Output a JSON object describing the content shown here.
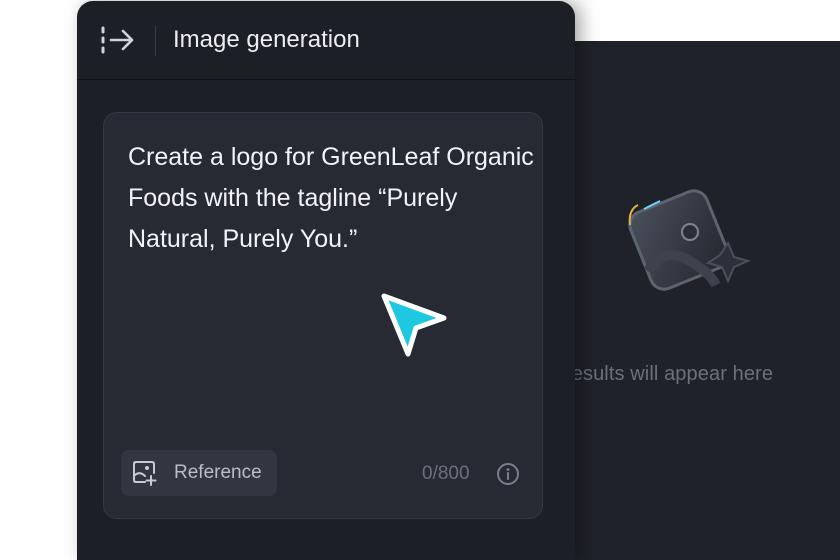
{
  "colors": {
    "panel_background": "#1c1f26",
    "card_background": "#272a33",
    "accent_cursor": "#1ec8e0"
  },
  "header": {
    "collapse_icon": "panel-collapse-arrow-icon",
    "title": "Image generation"
  },
  "prompt": {
    "text": "Create a logo for GreenLeaf Organic Foods with the tagline “Purely Natural, Purely You.”",
    "char_count": "0/800"
  },
  "reference_button": {
    "label": "Reference",
    "icon": "image-add-icon"
  },
  "results": {
    "placeholder_icon": "image-placeholder-icon",
    "empty_text": "ated results will appear here"
  }
}
